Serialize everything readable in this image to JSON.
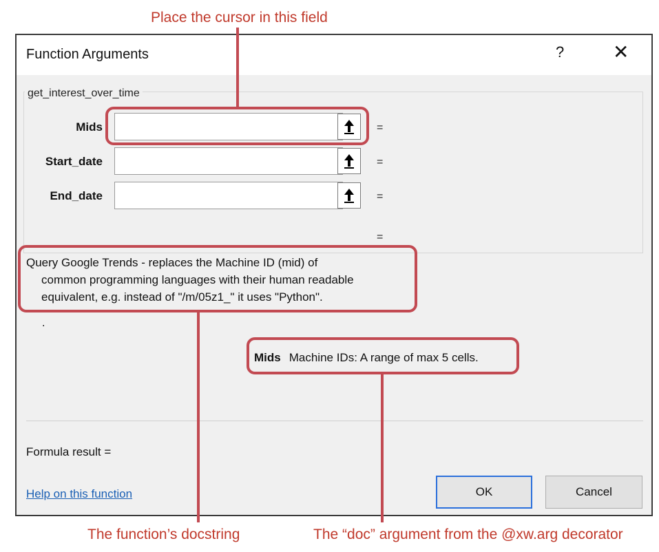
{
  "callouts": {
    "top": "Place the cursor in this field",
    "bottom_left": "The function’s docstring",
    "bottom_right": "The “doc” argument from the @xw.arg decorator"
  },
  "dialog": {
    "title": "Function Arguments",
    "help_glyph": "?",
    "close_glyph": "✕",
    "function_name": "get_interest_over_time",
    "args": [
      {
        "label": "Mids",
        "value": "",
        "equals": "="
      },
      {
        "label": "Start_date",
        "value": "",
        "equals": "="
      },
      {
        "label": "End_date",
        "value": "",
        "equals": "="
      }
    ],
    "result_equals": "=",
    "description_lines": [
      "Query Google Trends - replaces the Machine ID (mid) of",
      "common programming languages with their human readable",
      "equivalent, e.g. instead of \"/m/05z1_\" it uses \"Python\"."
    ],
    "description_trailer": ".",
    "arg_help": {
      "name": "Mids",
      "text": "Machine IDs: A range of max 5 cells."
    },
    "formula_result": "Formula result =",
    "help_link": "Help on this function",
    "ok_label": "OK",
    "cancel_label": "Cancel"
  },
  "icons": {
    "collapse": "up-arrow-icon"
  },
  "colors": {
    "annotation": "#c24a52",
    "dialog_bg": "#f0f0f0",
    "link": "#1a5fb4"
  }
}
